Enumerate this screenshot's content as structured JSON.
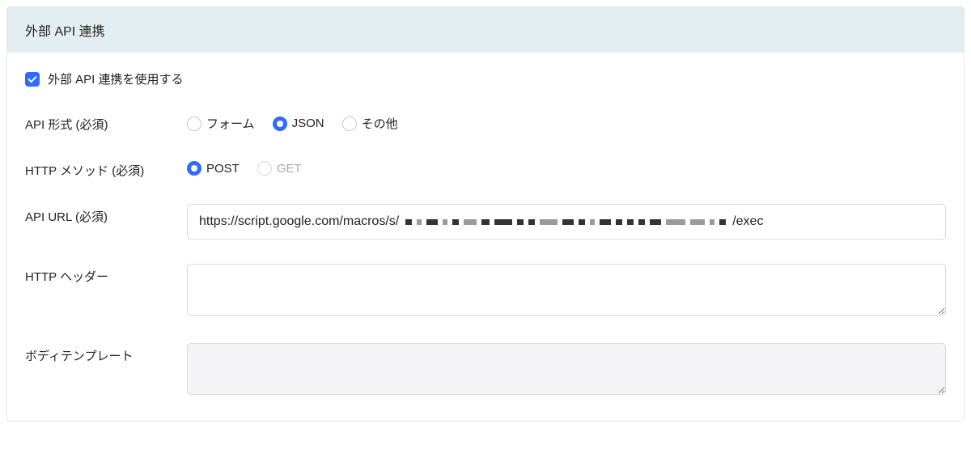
{
  "panel": {
    "title": "外部 API 連携"
  },
  "enable": {
    "label": "外部 API 連携を使用する",
    "checked": true
  },
  "api_format": {
    "label": "API 形式 (必須)",
    "options": {
      "form": "フォーム",
      "json": "JSON",
      "other": "その他"
    },
    "selected": "json"
  },
  "http_method": {
    "label": "HTTP メソッド (必須)",
    "options": {
      "post": "POST",
      "get": "GET"
    },
    "selected": "post",
    "get_disabled": true
  },
  "api_url": {
    "label": "API URL (必須)",
    "prefix": "https://script.google.com/macros/s/",
    "suffix": "/exec"
  },
  "http_header": {
    "label": "HTTP ヘッダー",
    "value": ""
  },
  "body_template": {
    "label": "ボディテンプレート",
    "value": "",
    "disabled": true
  }
}
